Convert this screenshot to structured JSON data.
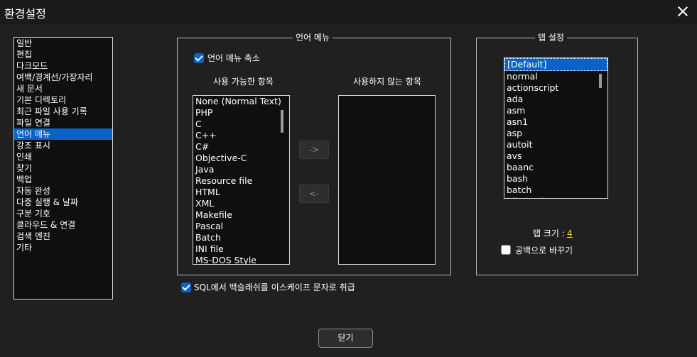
{
  "window": {
    "title": "환경설정"
  },
  "categories": {
    "items": [
      "일반",
      "편집",
      "다크모드",
      "여백/경계선/가장자리",
      "새 문서",
      "기본 디렉토리",
      "최근 파일 사용 기록",
      "파일 연결",
      "언어 메뉴",
      "강조 표시",
      "인쇄",
      "찾기",
      "백업",
      "자동 완성",
      "다중 실행 & 날짜",
      "구분 기호",
      "클라우드 & 연결",
      "검색 엔진",
      "기타"
    ],
    "selected_index": 8
  },
  "language_menu": {
    "group_label": "언어 메뉴",
    "compact_label": "언어 메뉴 축소",
    "compact_checked": true,
    "available_header": "사용 가능한 항목",
    "unused_header": "사용하지 않는 항목",
    "available_items": [
      "None (Normal Text)",
      "PHP",
      "C",
      "C++",
      "C#",
      "Objective-C",
      "Java",
      "Resource file",
      "HTML",
      "XML",
      "Makefile",
      "Pascal",
      "Batch",
      "INI file",
      "MS-DOS Style"
    ],
    "unused_items": [],
    "move_right_label": "->",
    "move_left_label": "<-"
  },
  "sql_escape": {
    "label": "SQL에서 백슬래쉬를 이스케이프 문자로 취급",
    "checked": true
  },
  "tab_settings": {
    "group_label": "탭 설정",
    "items": [
      "[Default]",
      "normal",
      "actionscript",
      "ada",
      "asm",
      "asn1",
      "asp",
      "autoit",
      "avs",
      "baanc",
      "bash",
      "batch",
      "blitzbasic"
    ],
    "selected_index": 0,
    "size_label": "탭 크기 :",
    "size_value": "4",
    "replace_label": "공백으로 바꾸기",
    "replace_checked": false
  },
  "close_button": {
    "label": "닫기"
  },
  "colors": {
    "accent": "#0a62c9",
    "background": "#202020",
    "tab_size_value": "#ffd700"
  }
}
